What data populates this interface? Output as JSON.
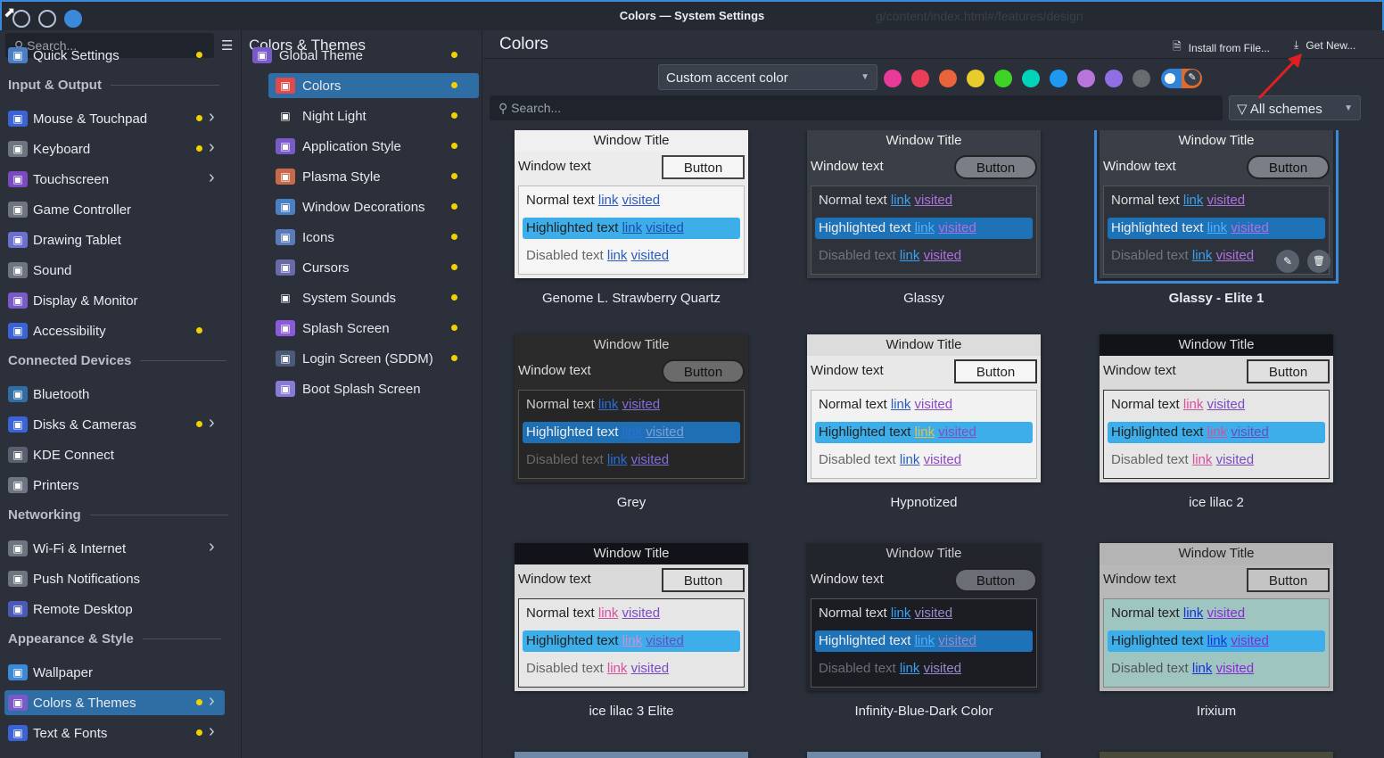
{
  "window": {
    "title": "Colors — System Settings",
    "ghost_url": "g/content/index.html#/features/design"
  },
  "sidebar": {
    "search_placeholder": "Search...",
    "items": [
      {
        "label": "Quick Settings",
        "icon": "quick-settings-icon",
        "dot": true,
        "chevron": false,
        "top": 1
      },
      {
        "label": "Mouse & Touchpad",
        "icon": "mouse-icon",
        "dot": true,
        "chevron": true
      },
      {
        "label": "Keyboard",
        "icon": "keyboard-icon",
        "dot": true,
        "chevron": true
      },
      {
        "label": "Touchscreen",
        "icon": "touchscreen-icon",
        "dot": false,
        "chevron": true
      },
      {
        "label": "Game Controller",
        "icon": "game-controller-icon",
        "dot": false,
        "chevron": false
      },
      {
        "label": "Drawing Tablet",
        "icon": "drawing-tablet-icon",
        "dot": false,
        "chevron": false
      },
      {
        "label": "Sound",
        "icon": "sound-icon",
        "dot": false,
        "chevron": false
      },
      {
        "label": "Display & Monitor",
        "icon": "display-icon",
        "dot": false,
        "chevron": false
      },
      {
        "label": "Accessibility",
        "icon": "accessibility-icon",
        "dot": true,
        "chevron": false
      },
      {
        "label": "Bluetooth",
        "icon": "bluetooth-icon",
        "dot": false,
        "chevron": false
      },
      {
        "label": "Disks & Cameras",
        "icon": "disks-icon",
        "dot": true,
        "chevron": true
      },
      {
        "label": "KDE Connect",
        "icon": "kde-connect-icon",
        "dot": false,
        "chevron": false
      },
      {
        "label": "Printers",
        "icon": "printer-icon",
        "dot": false,
        "chevron": false
      },
      {
        "label": "Wi-Fi & Internet",
        "icon": "wifi-icon",
        "dot": false,
        "chevron": true
      },
      {
        "label": "Push Notifications",
        "icon": "push-notifications-icon",
        "dot": false,
        "chevron": false
      },
      {
        "label": "Remote Desktop",
        "icon": "remote-desktop-icon",
        "dot": false,
        "chevron": false
      },
      {
        "label": "Wallpaper",
        "icon": "wallpaper-icon",
        "dot": false,
        "chevron": false
      },
      {
        "label": "Colors & Themes",
        "icon": "colors-themes-icon",
        "dot": true,
        "chevron": true,
        "selected": true
      },
      {
        "label": "Text & Fonts",
        "icon": "text-fonts-icon",
        "dot": true,
        "chevron": true
      }
    ],
    "headings": [
      "Input & Output",
      "Connected Devices",
      "Networking",
      "Appearance & Style"
    ]
  },
  "middle": {
    "heading": "Colors & Themes",
    "items": [
      {
        "label": "Global Theme",
        "icon": "global-theme-icon",
        "dot": true
      },
      {
        "label": "Colors",
        "icon": "colors-icon",
        "dot": true,
        "selected": true
      },
      {
        "label": "Night Light",
        "icon": "night-light-icon",
        "dot": true
      },
      {
        "label": "Application Style",
        "icon": "application-style-icon",
        "dot": true
      },
      {
        "label": "Plasma Style",
        "icon": "plasma-style-icon",
        "dot": true
      },
      {
        "label": "Window Decorations",
        "icon": "window-decorations-icon",
        "dot": true
      },
      {
        "label": "Icons",
        "icon": "icons-icon",
        "dot": true
      },
      {
        "label": "Cursors",
        "icon": "cursors-icon",
        "dot": true
      },
      {
        "label": "System Sounds",
        "icon": "system-sounds-icon",
        "dot": true
      },
      {
        "label": "Splash Screen",
        "icon": "splash-screen-icon",
        "dot": true
      },
      {
        "label": "Login Screen (SDDM)",
        "icon": "login-screen-icon",
        "dot": true
      },
      {
        "label": "Boot Splash Screen",
        "icon": "boot-splash-icon",
        "dot": false
      }
    ]
  },
  "main": {
    "title": "Colors",
    "install_label": "Install from File...",
    "get_new_label": "Get New...",
    "accent_select": "Custom accent color",
    "accent_swatches": [
      "#e93a9a",
      "#e93d58",
      "#e9643a",
      "#e8cb2d",
      "#3dd425",
      "#00d3b8",
      "#1d99f3",
      "#b875dc",
      "#926ee4",
      "#686b6f"
    ],
    "search_placeholder": "Search...",
    "filter_label": "All schemes"
  },
  "schemes": [
    {
      "name": "Genome L. Strawberry Quartz",
      "title_bg": "#f0f0f0",
      "title_fg": "#222",
      "win_bg": "#ececec",
      "win_fg": "#222",
      "btn_bg": "#f5f5f5",
      "btn_fg": "#222",
      "btn_border": "#444",
      "btn_round": false,
      "view_bg": "#f5f5f5",
      "view_border": "#bbb",
      "view_fg": "#222",
      "hl_bg": "#3daee9",
      "hl_fg": "#222",
      "link": "#2a5cbf",
      "visited": "#2a5cbf",
      "hl_link": "#1f4ea8",
      "hl_visited": "#1f4ea8",
      "dis_fg": "#666",
      "normal_text": "Normal text",
      "highlighted_text": "Highlighted text",
      "disabled_text": "Disabled text",
      "link_text": "link",
      "visited_text": "visited",
      "window_title": "Window Title",
      "window_text": "Window text",
      "button": "Button"
    },
    {
      "name": "Glassy",
      "title_bg": "#3a3e47",
      "title_fg": "#eee",
      "win_bg": "#3a3e47",
      "win_fg": "#eee",
      "btn_bg": "#7a7e86",
      "btn_fg": "#111",
      "btn_border": "#222",
      "btn_round": true,
      "view_bg": "#2e323a",
      "view_border": "#555",
      "view_fg": "#ddd",
      "hl_bg": "#1d72b8",
      "hl_fg": "#eee",
      "link": "#3aa0f0",
      "visited": "#b070e0",
      "hl_link": "#4fb0ff",
      "hl_visited": "#b070e0",
      "dis_fg": "#707480",
      "normal_text": "Normal text",
      "highlighted_text": "Highlighted text",
      "disabled_text": "Disabled text",
      "link_text": "link",
      "visited_text": "visited",
      "window_title": "Window Title",
      "window_text": "Window text",
      "button": "Button"
    },
    {
      "name": "Glassy - Elite 1",
      "selected": true,
      "title_bg": "#3a3e47",
      "title_fg": "#eee",
      "win_bg": "#3a3e47",
      "win_fg": "#eee",
      "btn_bg": "#7a7e86",
      "btn_fg": "#111",
      "btn_border": "#222",
      "btn_round": true,
      "view_bg": "#2e323a",
      "view_border": "#555",
      "view_fg": "#ddd",
      "hl_bg": "#1d72b8",
      "hl_fg": "#eee",
      "link": "#3aa0f0",
      "visited": "#b070e0",
      "hl_link": "#4fb0ff",
      "hl_visited": "#b070e0",
      "dis_fg": "#707480",
      "normal_text": "Normal text",
      "highlighted_text": "Highlighted text",
      "disabled_text": "Disabled text",
      "link_text": "link",
      "visited_text": "visited",
      "window_title": "Window Title",
      "window_text": "Window text",
      "button": "Button"
    },
    {
      "name": "Grey",
      "title_bg": "#2b2b2b",
      "title_fg": "#ccc",
      "win_bg": "#2b2b2b",
      "win_fg": "#ddd",
      "btn_bg": "#6b6b6b",
      "btn_fg": "#111",
      "btn_border": "#222",
      "btn_round": true,
      "view_bg": "#262626",
      "view_border": "#555",
      "view_fg": "#ccc",
      "hl_bg": "#1f6fb5",
      "hl_fg": "#eee",
      "link": "#2b6fd8",
      "visited": "#7f6fd8",
      "hl_link": "#2b6fd8",
      "hl_visited": "#7f9fd8",
      "dis_fg": "#6a6a6a",
      "normal_text": "Normal text",
      "highlighted_text": "Highlighted text",
      "disabled_text": "Disabled text",
      "link_text": "link",
      "visited_text": "visited",
      "window_title": "Window Title",
      "window_text": "Window text",
      "button": "Button"
    },
    {
      "name": "Hypnotized",
      "title_bg": "#dcdcdc",
      "title_fg": "#222",
      "win_bg": "#e8e8e8",
      "win_fg": "#222",
      "btn_bg": "#f5f5f5",
      "btn_fg": "#222",
      "btn_border": "#333",
      "btn_round": false,
      "view_bg": "#f2f2f2",
      "view_border": "#bbb",
      "view_fg": "#222",
      "hl_bg": "#3daee9",
      "hl_fg": "#222",
      "link": "#2a5cbf",
      "visited": "#8a4abf",
      "hl_link": "#e6c14a",
      "hl_visited": "#8a4abf",
      "dis_fg": "#666",
      "normal_text": "Normal text",
      "highlighted_text": "Highlighted text",
      "disabled_text": "Disabled text",
      "link_text": "link",
      "visited_text": "visited",
      "window_title": "Window Title",
      "window_text": "Window text",
      "button": "Button"
    },
    {
      "name": "ice lilac 2",
      "title_bg": "#111318",
      "title_fg": "#ddd",
      "win_bg": "#dadada",
      "win_fg": "#222",
      "btn_bg": "#e0e0e0",
      "btn_fg": "#222",
      "btn_border": "#333",
      "btn_round": false,
      "view_bg": "#e6e6e6",
      "view_border": "#333",
      "view_fg": "#222",
      "hl_bg": "#3daee9",
      "hl_fg": "#222",
      "link": "#d9509a",
      "visited": "#7a4ac0",
      "hl_link": "#d9509a",
      "hl_visited": "#6a4ac0",
      "dis_fg": "#666",
      "normal_text": "Normal text",
      "highlighted_text": "Highlighted text",
      "disabled_text": "Disabled text",
      "link_text": "link",
      "visited_text": "visited",
      "window_title": "Window Title",
      "window_text": "Window text",
      "button": "Button"
    },
    {
      "name": "ice lilac 3 Elite",
      "title_bg": "#111318",
      "title_fg": "#ddd",
      "win_bg": "#dadada",
      "win_fg": "#222",
      "btn_bg": "#e0e0e0",
      "btn_fg": "#222",
      "btn_border": "#333",
      "btn_round": false,
      "view_bg": "#e6e6e6",
      "view_border": "#333",
      "view_fg": "#222",
      "hl_bg": "#3daee9",
      "hl_fg": "#222",
      "link": "#d9509a",
      "visited": "#7a4ac0",
      "hl_link": "#d98ad0",
      "hl_visited": "#6a4ac0",
      "dis_fg": "#666",
      "normal_text": "Normal text",
      "highlighted_text": "Highlighted text",
      "disabled_text": "Disabled text",
      "link_text": "link",
      "visited_text": "visited",
      "window_title": "Window Title",
      "window_text": "Window text",
      "button": "Button"
    },
    {
      "name": "Infinity-Blue-Dark Color",
      "title_bg": "#22252c",
      "title_fg": "#ccc",
      "win_bg": "#22252c",
      "win_fg": "#ddd",
      "btn_bg": "#6b6e74",
      "btn_fg": "#111",
      "btn_border": "#222",
      "btn_round": true,
      "view_bg": "#1b1d22",
      "view_border": "#555",
      "view_fg": "#ddd",
      "hl_bg": "#1d72b8",
      "hl_fg": "#eee",
      "link": "#3aa0f0",
      "visited": "#9a8ac8",
      "hl_link": "#4fb0ff",
      "hl_visited": "#9a8ac8",
      "dis_fg": "#6a6e76",
      "normal_text": "Normal text",
      "highlighted_text": "Highlighted text",
      "disabled_text": "Disabled text",
      "link_text": "link",
      "visited_text": "visited",
      "window_title": "Window Title",
      "window_text": "Window text",
      "button": "Button"
    },
    {
      "name": "Irixium",
      "title_bg": "#b4b4b4",
      "title_fg": "#222",
      "win_bg": "#b8b8b8",
      "win_fg": "#222",
      "btn_bg": "#c4c4c4",
      "btn_fg": "#222",
      "btn_border": "#333",
      "btn_round": false,
      "view_bg": "#9ec5c0",
      "view_border": "#888",
      "view_fg": "#222",
      "hl_bg": "#3daee9",
      "hl_fg": "#222",
      "link": "#1a2fd8",
      "visited": "#8a2ad0",
      "hl_link": "#1a2fd8",
      "hl_visited": "#8a2ad0",
      "dis_fg": "#555",
      "normal_text": "Normal text",
      "highlighted_text": "Highlighted text",
      "disabled_text": "Disabled text",
      "link_text": "link",
      "visited_text": "visited",
      "window_title": "Window Title",
      "window_text": "Window text",
      "button": "Button"
    }
  ]
}
